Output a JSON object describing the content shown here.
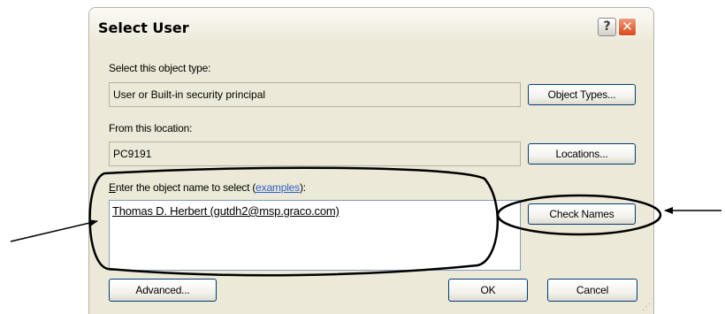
{
  "dialog": {
    "title": "Select User",
    "help_label": "?",
    "close_label": "✕",
    "object_type": {
      "label": "Select this object type:",
      "value": "User or Built-in security principal",
      "button": "Object Types..."
    },
    "location": {
      "label": "From this location:",
      "value": "PC9191",
      "button": "Locations..."
    },
    "object_name": {
      "label_hotkey": "E",
      "label_rest": "nter the object name to select (",
      "label_link": "examples",
      "label_end": "):",
      "value": "Thomas D. Herbert (gutdh2@msp.graco.com)",
      "check_button": "Check Names"
    },
    "buttons": {
      "advanced": "Advanced...",
      "ok": "OK",
      "cancel": "Cancel"
    }
  },
  "annotations": {
    "color": "#000000",
    "arrows": [
      "left-arrow-to-name-field",
      "right-arrow-to-check-names"
    ],
    "highlights": [
      "ellipse-around-name-field",
      "ellipse-around-check-names"
    ]
  }
}
